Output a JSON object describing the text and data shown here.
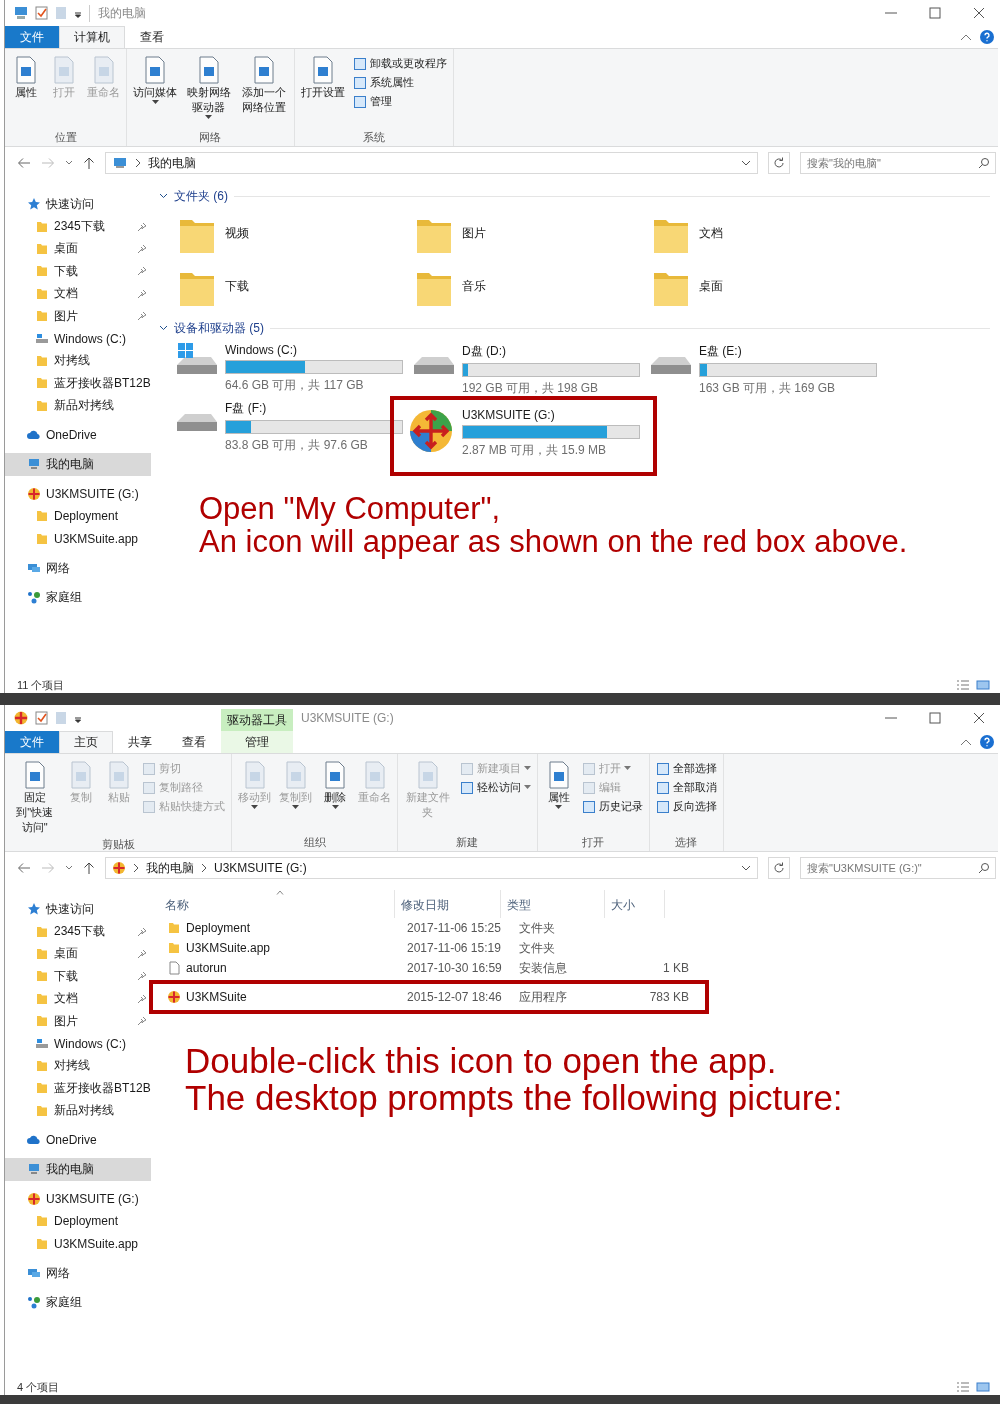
{
  "windows": [
    {
      "title": "我的电脑",
      "tabs": [
        {
          "label": "文件",
          "kind": "file",
          "selected": false
        },
        {
          "label": "计算机",
          "kind": "tab",
          "selected": true
        },
        {
          "label": "查看",
          "kind": "tab",
          "selected": false
        }
      ],
      "ribbon": [
        {
          "label": "位置",
          "items": [
            {
              "label": "属性",
              "kind": "large",
              "disabled": false,
              "dropdown": false
            },
            {
              "label": "打开",
              "kind": "large",
              "disabled": true,
              "dropdown": false
            },
            {
              "label": "重命名",
              "kind": "large",
              "disabled": true,
              "dropdown": false
            }
          ]
        },
        {
          "label": "网络",
          "items": [
            {
              "label": "访问媒体",
              "kind": "large",
              "disabled": false,
              "dropdown": true
            },
            {
              "label": "映射网络驱动器",
              "kind": "large",
              "disabled": false,
              "dropdown": true
            },
            {
              "label": "添加一个网络位置",
              "kind": "large",
              "disabled": false,
              "dropdown": false
            }
          ]
        },
        {
          "label": "系统",
          "items": [
            {
              "label": "打开设置",
              "kind": "large",
              "disabled": false,
              "dropdown": false
            },
            {
              "label": "卸载或更改程序",
              "kind": "small",
              "disabled": false,
              "dropdown": false
            },
            {
              "label": "系统属性",
              "kind": "small",
              "disabled": false,
              "dropdown": false
            },
            {
              "label": "管理",
              "kind": "small",
              "disabled": false,
              "dropdown": false
            }
          ]
        }
      ],
      "address": {
        "crumbs": [
          "我的电脑"
        ]
      },
      "search": {
        "placeholder": "搜索\"我的电脑\""
      },
      "sidebar": [
        {
          "label": "快速访问",
          "kind": "quick",
          "selected": false,
          "children": [
            {
              "label": "2345下载",
              "kind": "folder",
              "pinned": true,
              "selected": false
            },
            {
              "label": "桌面",
              "kind": "folder",
              "pinned": true,
              "selected": false
            },
            {
              "label": "下载",
              "kind": "folder",
              "pinned": true,
              "selected": false
            },
            {
              "label": "文档",
              "kind": "folder",
              "pinned": true,
              "selected": false
            },
            {
              "label": "图片",
              "kind": "folder",
              "pinned": true,
              "selected": false
            },
            {
              "label": "Windows (C:)",
              "kind": "drive",
              "pinned": false,
              "selected": false
            },
            {
              "label": "对拷线",
              "kind": "folder",
              "pinned": false,
              "selected": false
            },
            {
              "label": "蓝牙接收器BT12B",
              "kind": "folder",
              "pinned": false,
              "selected": false
            },
            {
              "label": "新品对拷线",
              "kind": "folder",
              "pinned": false,
              "selected": false
            }
          ]
        },
        {
          "label": "OneDrive",
          "kind": "cloud",
          "selected": false
        },
        {
          "label": "我的电脑",
          "kind": "pc",
          "selected": true
        },
        {
          "label": "U3KMSUITE (G:)",
          "kind": "app",
          "selected": false,
          "children": [
            {
              "label": "Deployment",
              "kind": "folder",
              "pinned": false,
              "selected": false
            },
            {
              "label": "U3KMSuite.app",
              "kind": "folder",
              "pinned": false,
              "selected": false
            }
          ]
        },
        {
          "label": "网络",
          "kind": "network",
          "selected": false
        },
        {
          "label": "家庭组",
          "kind": "homegroup",
          "selected": false
        }
      ],
      "content": {
        "kind": "tiles",
        "sections": [
          {
            "label": "文件夹 (6)",
            "expanded": true,
            "items": [
              {
                "label": "视频",
                "kind": "folder"
              },
              {
                "label": "图片",
                "kind": "folder"
              },
              {
                "label": "文档",
                "kind": "folder"
              },
              {
                "label": "下载",
                "kind": "folder"
              },
              {
                "label": "音乐",
                "kind": "folder"
              },
              {
                "label": "桌面",
                "kind": "folder"
              }
            ]
          },
          {
            "label": "设备和驱动器 (5)",
            "expanded": true,
            "items": [
              {
                "label": "Windows (C:)",
                "kind": "system_disk",
                "level": 0.45,
                "free": "64.6 GB 可用，共 117 GB",
                "annotated": false
              },
              {
                "label": "D盘 (D:)",
                "kind": "disk",
                "level": 0.03,
                "free": "192 GB 可用，共 198 GB",
                "annotated": false
              },
              {
                "label": "E盘 (E:)",
                "kind": "disk",
                "level": 0.04,
                "free": "163 GB 可用，共 169 GB",
                "annotated": false
              },
              {
                "label": "F盘 (F:)",
                "kind": "disk",
                "level": 0.14,
                "free": "83.8 GB 可用，共 97.6 GB",
                "annotated": false
              },
              {
                "label": "U3KMSUITE (G:)",
                "kind": "app_disk",
                "level": 0.82,
                "free": "2.87 MB 可用，共 15.9 MB",
                "annotated": true
              }
            ]
          }
        ]
      },
      "caption": [
        "Open \"My Computer\",",
        "An icon will appear as shown on the red box above."
      ],
      "status": "11 个项目"
    },
    {
      "title": "U3KMSUITE (G:)",
      "tabs": [
        {
          "label": "文件",
          "kind": "file",
          "selected": false
        },
        {
          "label": "主页",
          "kind": "tab",
          "selected": true
        },
        {
          "label": "共享",
          "kind": "tab",
          "selected": false
        },
        {
          "label": "查看",
          "kind": "tab",
          "selected": false
        },
        {
          "label": "管理",
          "kind": "context",
          "context_label": "驱动器工具",
          "selected": false
        }
      ],
      "ribbon": [
        {
          "label": "剪贴板",
          "items": [
            {
              "label": "固定到\"快速访问\"",
              "kind": "large",
              "disabled": false,
              "dropdown": false
            },
            {
              "label": "复制",
              "kind": "large",
              "disabled": true,
              "dropdown": false
            },
            {
              "label": "粘贴",
              "kind": "large",
              "disabled": true,
              "dropdown": false
            },
            {
              "label": "剪切",
              "kind": "small",
              "disabled": true,
              "dropdown": false
            },
            {
              "label": "复制路径",
              "kind": "small",
              "disabled": true,
              "dropdown": false
            },
            {
              "label": "粘贴快捷方式",
              "kind": "small",
              "disabled": true,
              "dropdown": false
            }
          ]
        },
        {
          "label": "组织",
          "items": [
            {
              "label": "移动到",
              "kind": "large",
              "disabled": true,
              "dropdown": true
            },
            {
              "label": "复制到",
              "kind": "large",
              "disabled": true,
              "dropdown": true
            },
            {
              "label": "删除",
              "kind": "large",
              "disabled": false,
              "dropdown": true
            },
            {
              "label": "重命名",
              "kind": "large",
              "disabled": true,
              "dropdown": false
            }
          ]
        },
        {
          "label": "新建",
          "items": [
            {
              "label": "新建文件夹",
              "kind": "large",
              "disabled": true,
              "dropdown": false
            },
            {
              "label": "新建项目",
              "kind": "small",
              "disabled": true,
              "dropdown": true
            },
            {
              "label": "轻松访问",
              "kind": "small",
              "disabled": false,
              "dropdown": true
            }
          ]
        },
        {
          "label": "打开",
          "items": [
            {
              "label": "属性",
              "kind": "large",
              "disabled": false,
              "dropdown": true
            },
            {
              "label": "打开",
              "kind": "small",
              "disabled": true,
              "dropdown": true
            },
            {
              "label": "编辑",
              "kind": "small",
              "disabled": true,
              "dropdown": false
            },
            {
              "label": "历史记录",
              "kind": "small",
              "disabled": false,
              "dropdown": false
            }
          ]
        },
        {
          "label": "选择",
          "items": [
            {
              "label": "全部选择",
              "kind": "small",
              "disabled": false,
              "dropdown": false
            },
            {
              "label": "全部取消",
              "kind": "small",
              "disabled": false,
              "dropdown": false
            },
            {
              "label": "反向选择",
              "kind": "small",
              "disabled": false,
              "dropdown": false
            }
          ]
        }
      ],
      "address": {
        "crumbs": [
          "我的电脑",
          "U3KMSUITE (G:)"
        ]
      },
      "search": {
        "placeholder": "搜索\"U3KMSUITE (G:)\""
      },
      "sidebar": [
        {
          "label": "快速访问",
          "kind": "quick",
          "selected": false,
          "children": [
            {
              "label": "2345下载",
              "kind": "folder",
              "pinned": true,
              "selected": false
            },
            {
              "label": "桌面",
              "kind": "folder",
              "pinned": true,
              "selected": false
            },
            {
              "label": "下载",
              "kind": "folder",
              "pinned": true,
              "selected": false
            },
            {
              "label": "文档",
              "kind": "folder",
              "pinned": true,
              "selected": false
            },
            {
              "label": "图片",
              "kind": "folder",
              "pinned": true,
              "selected": false
            },
            {
              "label": "Windows (C:)",
              "kind": "drive",
              "pinned": false,
              "selected": false
            },
            {
              "label": "对拷线",
              "kind": "folder",
              "pinned": false,
              "selected": false
            },
            {
              "label": "蓝牙接收器BT12B",
              "kind": "folder",
              "pinned": false,
              "selected": false
            },
            {
              "label": "新品对拷线",
              "kind": "folder",
              "pinned": false,
              "selected": false
            }
          ]
        },
        {
          "label": "OneDrive",
          "kind": "cloud",
          "selected": false
        },
        {
          "label": "我的电脑",
          "kind": "pc",
          "selected": true
        },
        {
          "label": "U3KMSUITE (G:)",
          "kind": "app",
          "selected": false,
          "children": [
            {
              "label": "Deployment",
              "kind": "folder",
              "pinned": false,
              "selected": false
            },
            {
              "label": "U3KMSuite.app",
              "kind": "folder",
              "pinned": false,
              "selected": false
            }
          ]
        },
        {
          "label": "网络",
          "kind": "network",
          "selected": false
        },
        {
          "label": "家庭组",
          "kind": "homegroup",
          "selected": false
        }
      ],
      "content": {
        "kind": "details",
        "columns": [
          {
            "label": "名称",
            "sorted": true
          },
          {
            "label": "修改日期",
            "sorted": false
          },
          {
            "label": "类型",
            "sorted": false
          },
          {
            "label": "大小",
            "sorted": false
          }
        ],
        "rows": [
          {
            "name": "Deployment",
            "date": "2017-11-06 15:25",
            "type": "文件夹",
            "kind": "folder",
            "annotated": false
          },
          {
            "name": "U3KMSuite.app",
            "date": "2017-11-06 15:19",
            "type": "文件夹",
            "kind": "folder",
            "annotated": false
          },
          {
            "name": "autorun",
            "date": "2017-10-30 16:59",
            "type": "安装信息",
            "size": "1 KB",
            "kind": "file",
            "annotated": false
          },
          {
            "name": "U3KMSuite",
            "date": "2015-12-07 18:46",
            "type": "应用程序",
            "size": "783 KB",
            "kind": "app",
            "annotated": true
          }
        ]
      },
      "caption": [
        "Double-click this icon to open the app.",
        "The desktop prompts the following picture:"
      ],
      "status": "4 个项目"
    }
  ]
}
